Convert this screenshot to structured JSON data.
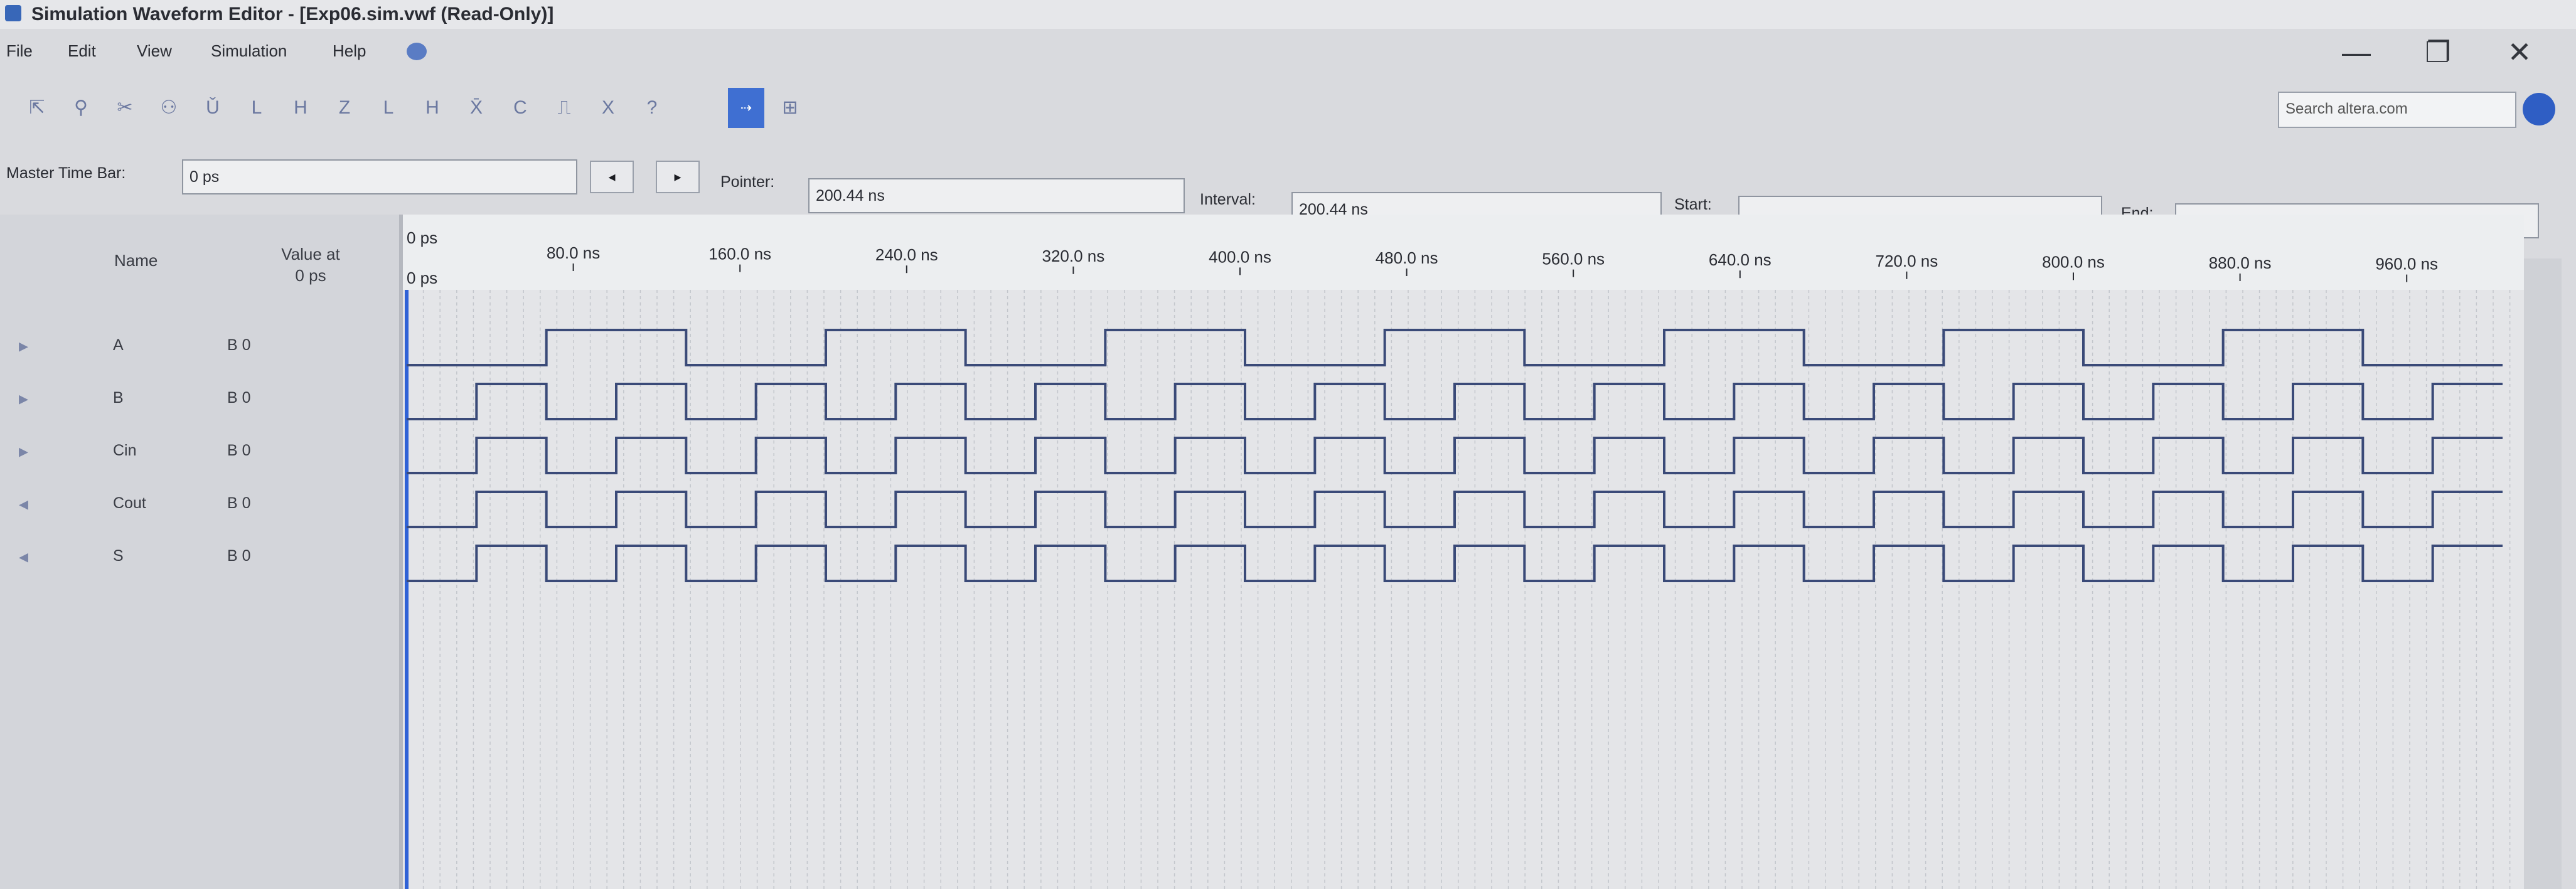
{
  "window": {
    "title": "Simulation Waveform Editor - [Exp06.sim.vwf (Read-Only)]"
  },
  "menu": [
    "File",
    "Edit",
    "View",
    "Simulation",
    "Help"
  ],
  "window_controls": {
    "minimize": "—",
    "restore": "❐",
    "close": "✕"
  },
  "toolbar": {
    "tools": [
      "select-icon",
      "zoom-icon",
      "cut-icon",
      "node-finder-icon",
      "uninitialized-icon",
      "forcing-low-icon",
      "forcing-high-icon",
      "high-impedance-icon",
      "weak-low-icon",
      "weak-high-icon",
      "invert-icon",
      "count-value-icon",
      "clock-icon",
      "arbitrary-value-icon",
      "random-value-icon",
      "snap-icon",
      "grid-icon"
    ],
    "active_label": "snap",
    "search_placeholder": "Search altera.com"
  },
  "timebar": {
    "master_label": "Master Time Bar:",
    "master_value": "0 ps",
    "pointer_label": "Pointer:",
    "pointer_value": "200.44 ns",
    "interval_label": "Interval:",
    "interval_value": "200.44 ns",
    "start_label": "Start:",
    "start_value": "",
    "end_label": "End:",
    "end_value": ""
  },
  "columns": {
    "name": "Name",
    "value_at": "Value at",
    "value_time": "0 ps"
  },
  "signals": [
    {
      "name": "A",
      "value": "B 0"
    },
    {
      "name": "B",
      "value": "B 0"
    },
    {
      "name": "Cin",
      "value": "B 0"
    },
    {
      "name": "Cout",
      "value": "B 0"
    },
    {
      "name": "S",
      "value": "B 0"
    }
  ],
  "time_axis": {
    "start_label": "0 ps",
    "cursor_label": "0 ps",
    "ticks": [
      "80.0 ns",
      "160.0 ns",
      "240.0 ns",
      "320.0 ns",
      "400.0 ns",
      "480.0 ns",
      "560.0 ns",
      "640.0 ns",
      "720.0 ns",
      "800.0 ns",
      "880.0 ns",
      "960.0 ns"
    ]
  },
  "waveforms": {
    "A": [
      0,
      0,
      1,
      1,
      0,
      0,
      1,
      1,
      0,
      0,
      1,
      1,
      0,
      0,
      1,
      1,
      0,
      0,
      1,
      1,
      0,
      0,
      1,
      1,
      0,
      0,
      1,
      1,
      0,
      0
    ],
    "B": [
      0,
      1,
      0,
      1,
      0,
      1,
      0,
      1,
      0,
      1,
      0,
      1,
      0,
      1,
      0,
      1,
      0,
      1,
      0,
      1,
      0,
      1,
      0,
      1,
      0,
      1,
      0,
      1,
      0,
      1
    ],
    "Cin": [
      0,
      1,
      0,
      1,
      0,
      1,
      0,
      1,
      0,
      1,
      0,
      1,
      0,
      1,
      0,
      1,
      0,
      1,
      0,
      1,
      0,
      1,
      0,
      1,
      0,
      1,
      0,
      1,
      0,
      1
    ],
    "Cout": [
      0,
      1,
      0,
      1,
      0,
      1,
      0,
      1,
      0,
      1,
      0,
      1,
      0,
      1,
      0,
      1,
      0,
      1,
      0,
      1,
      0,
      1,
      0,
      1,
      0,
      1,
      0,
      1,
      0,
      1
    ],
    "S": [
      0,
      1,
      0,
      1,
      0,
      1,
      0,
      1,
      0,
      1,
      0,
      1,
      0,
      1,
      0,
      1,
      0,
      1,
      0,
      1,
      0,
      1,
      0,
      1,
      0,
      1,
      0,
      1,
      0,
      1
    ]
  },
  "colors": {
    "wave": "#3a4a78",
    "cursor": "#2f62d6",
    "grid": "#c3c6cc"
  }
}
